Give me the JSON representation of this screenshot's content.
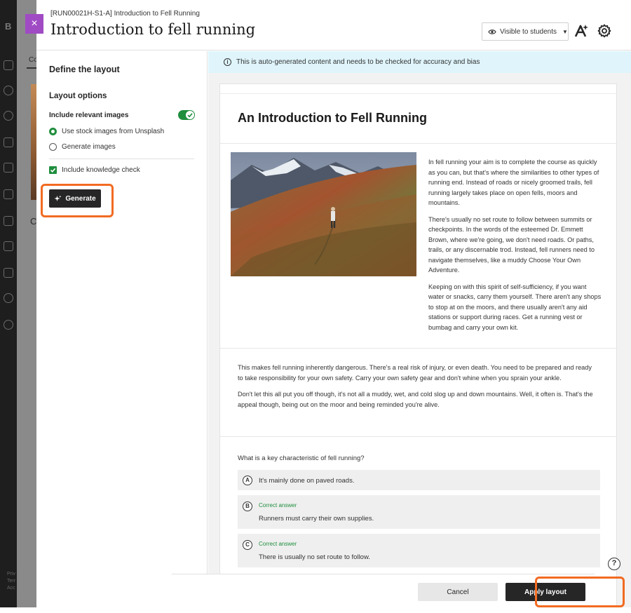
{
  "background_app": {
    "logo_letter": "B",
    "tab_label": "Co",
    "card_letter": "C",
    "footer_lines": [
      "Priv",
      "Terr",
      "Acc"
    ]
  },
  "header": {
    "course_code": "[RUN00021H-S1-A] Introduction to Fell Running",
    "title": "Introduction to fell running",
    "visibility_label": "Visible to students",
    "close_glyph": "×"
  },
  "left_panel": {
    "title": "Define the layout",
    "options_heading": "Layout options",
    "include_images_label": "Include relevant images",
    "include_images_on": true,
    "image_source_options": [
      {
        "label": "Use stock images from Unsplash",
        "selected": true
      },
      {
        "label": "Generate images",
        "selected": false
      }
    ],
    "knowledge_check_label": "Include knowledge check",
    "knowledge_check_checked": true,
    "generate_label": "Generate"
  },
  "preview": {
    "banner": "This is auto-generated content and needs to be checked for accuracy and bias",
    "doc_title": "An Introduction to Fell Running",
    "side_paragraphs": [
      "In fell running your aim is to complete the course as quickly as you can, but that's where the similarities to other types of running end. Instead of roads or nicely groomed trails, fell running largely takes place on open fells, moors and mountains.",
      "There's usually no set route to follow between summits or checkpoints. In the words of the esteemed Dr. Emmett Brown, where we're going, we don't need roads. Or paths, trails, or any discernable trod. Instead, fell runners need to navigate themselves, like a muddy Choose Your Own Adventure.",
      "Keeping on with this spirit of self-sufficiency, if you want water or snacks, carry them yourself. There aren't any shops to stop at on the moors, and there usually aren't any aid stations or support during races. Get a running vest or bumbag and carry your own kit."
    ],
    "full_paragraphs": [
      "This makes fell running inherently dangerous. There's a real risk of injury, or even death. You need to be prepared and ready to take responsibility for your own safety. Carry your own safety gear and don't whine when you sprain your ankle.",
      "Don't let this all put you off though, it's not all a muddy, wet, and cold slog up and down mountains. Well, it often is. That's the appeal though, being out on the moor and being reminded you're alive."
    ],
    "question": "What is a key characteristic of fell running?",
    "answers": [
      {
        "letter": "A",
        "text": "It's mainly done on paved roads.",
        "correct_label": ""
      },
      {
        "letter": "B",
        "text": "Runners must carry their own supplies.",
        "correct_label": "Correct answer"
      },
      {
        "letter": "C",
        "text": "There is usually no set route to follow.",
        "correct_label": "Correct answer"
      }
    ]
  },
  "footer": {
    "cancel_label": "Cancel",
    "apply_label": "Apply layout",
    "help_glyph": "?"
  },
  "colors": {
    "accent_purple": "#a04bc4",
    "success_green": "#1f8e3d",
    "highlight_orange": "#f26b22",
    "banner_blue": "#dff5fb"
  }
}
